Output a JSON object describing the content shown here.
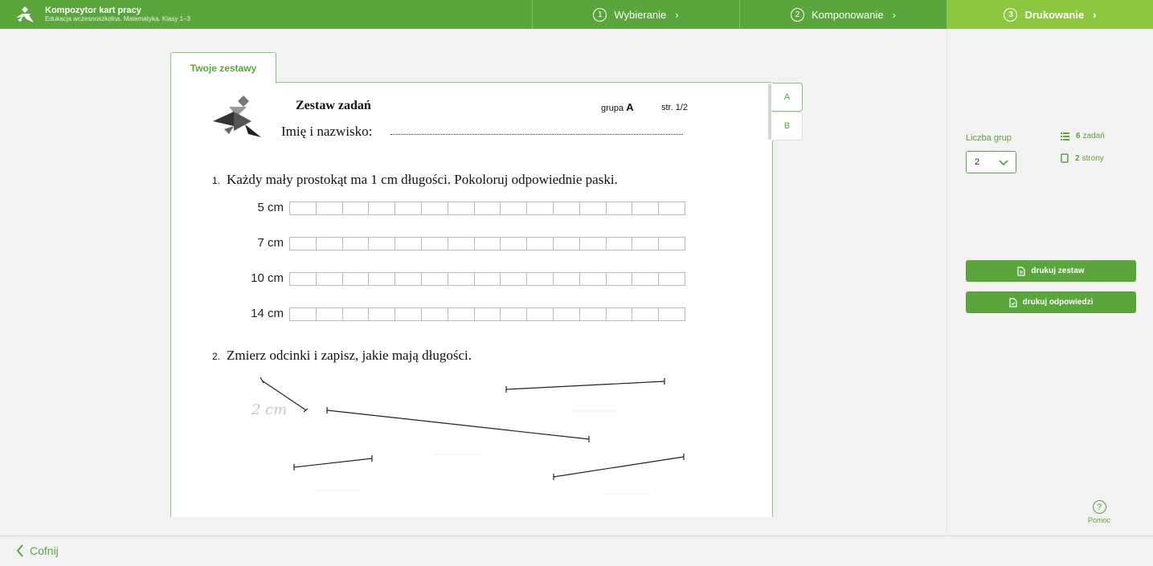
{
  "header": {
    "app_title": "Kompozytor kart pracy",
    "app_subtitle": "Edukacja wczesnoszkolna. Matematyka. Klasy 1–3",
    "steps": [
      {
        "num": "1",
        "label": "Wybieranie",
        "active": false
      },
      {
        "num": "2",
        "label": "Komponowanie",
        "active": false
      },
      {
        "num": "3",
        "label": "Drukowanie",
        "active": true
      }
    ]
  },
  "tabs": {
    "active": "Twoje zestawy"
  },
  "worksheet": {
    "title": "Zestaw zadań",
    "group_prefix": "grupa",
    "group": "A",
    "page": "str. 1/2",
    "name_label": "Imię i nazwisko:",
    "task1": {
      "num": "1.",
      "text": "Każdy mały prostokąt ma 1 cm długości. Pokoloruj odpowiednie paski.",
      "rows": [
        "5 cm",
        "7 cm",
        "10 cm",
        "14 cm"
      ],
      "cells_per_row": 15
    },
    "task2": {
      "num": "2.",
      "text": "Zmierz odcinki i zapisz, jakie mają długości.",
      "example_answer": "2 cm"
    }
  },
  "group_tabs": [
    "A",
    "B"
  ],
  "sidebar": {
    "groups_label": "Liczba grup",
    "groups_value": "2",
    "tasks_count": "6",
    "tasks_suffix": "zadań",
    "pages_count": "2",
    "pages_suffix": "strony",
    "print_set_label": "drukuj zestaw",
    "print_answers_label": "drukuj odpowiedzi",
    "help_label": "Pomoc"
  },
  "footer": {
    "back_label": "Cofnij"
  },
  "colors": {
    "primary_green": "#5aa53c",
    "active_step": "#8dc63f"
  }
}
